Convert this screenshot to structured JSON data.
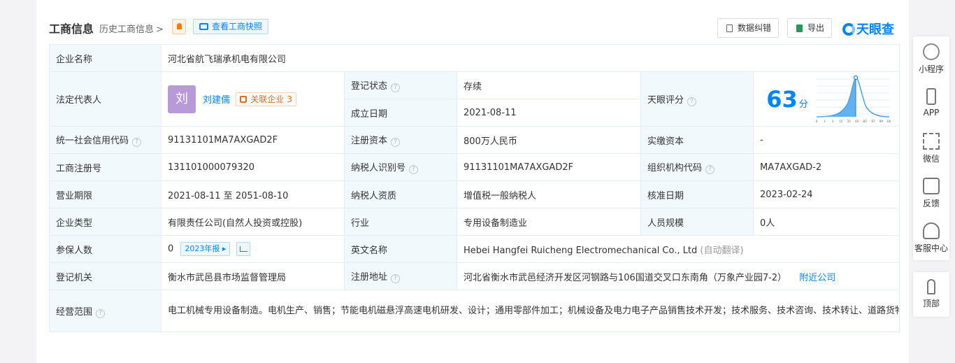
{
  "header": {
    "title": "工商信息",
    "history": "历史工商信息",
    "snapshot": "查看工商快照",
    "btn_fix": "数据纠错",
    "btn_export": "导出",
    "logo": "天眼查"
  },
  "labels": {
    "company_name": "企业名称",
    "legal_rep": "法定代表人",
    "reg_status": "登记状态",
    "tianyan_score": "天眼评分",
    "found_date": "成立日期",
    "credit_code": "统一社会信用代码",
    "reg_capital": "注册资本",
    "paid_capital": "实缴资本",
    "biz_reg_no": "工商注册号",
    "taxpayer_id": "纳税人识别号",
    "org_code": "组织机构代码",
    "biz_term": "营业期限",
    "taxpayer_qual": "纳税人资质",
    "approval_date": "核准日期",
    "company_type": "企业类型",
    "industry": "行业",
    "staff_size": "人员规模",
    "insured": "参保人数",
    "english_name": "英文名称",
    "reg_authority": "登记机关",
    "reg_address": "注册地址",
    "biz_scope": "经营范围"
  },
  "values": {
    "company_name": "河北省航飞瑞承机电有限公司",
    "legal_avatar": "刘",
    "legal_name": "刘建儒",
    "related_label": "关联企业",
    "related_count": "3",
    "reg_status": "存续",
    "score": "63",
    "score_unit": "分",
    "found_date": "2021-08-11",
    "credit_code": "91131101MA7AXGAD2F",
    "reg_capital": "800万人民币",
    "paid_capital": "-",
    "biz_reg_no": "131101000079320",
    "taxpayer_id": "91131101MA7AXGAD2F",
    "org_code": "MA7AXGAD-2",
    "biz_term": "2021-08-11 至 2051-08-10",
    "taxpayer_qual": "增值税一般纳税人",
    "approval_date": "2023-02-24",
    "company_type": "有限责任公司(自然人投资或控股)",
    "industry": "专用设备制造业",
    "staff_size": "0人",
    "insured": "0",
    "insured_year": "2023年报",
    "english_name": "Hebei Hangfei Ruicheng Electromechanical Co., Ltd",
    "english_note": "(自动翻译)",
    "reg_authority": "衡水市武邑县市场监督管理局",
    "reg_address": "河北省衡水市武邑经济开发区河钢路与106国道交叉口东南角（万象产业园7-2）",
    "nearby": "附近公司",
    "biz_scope": "电工机械专用设备制造。电机生产、销售；节能电机磁悬浮高速电机研发、设计；通用零部件加工；机械设备及电力电子产品销售技术开发；技术服务、技术咨询、技术转让、道路货物运输（不含危险货物）。（依法须经批准的项目，经相关部门批准后方可开展经营活动）"
  },
  "score_chart": {
    "ticks": [
      "0",
      "1",
      "3",
      "15",
      "35",
      "65",
      "85",
      "97",
      "99",
      "100"
    ],
    "marker_value": 63
  },
  "rail": [
    "小程序",
    "APP",
    "微信",
    "反馈",
    "客服中心"
  ],
  "rail_top": "顶部"
}
